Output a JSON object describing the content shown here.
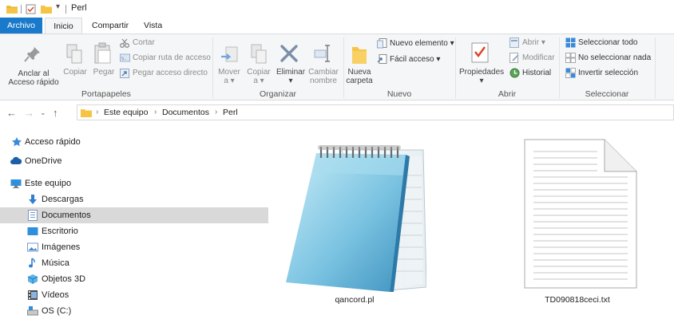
{
  "window": {
    "title": "Perl"
  },
  "tabs": [
    {
      "label": "Archivo"
    },
    {
      "label": "Inicio"
    },
    {
      "label": "Compartir"
    },
    {
      "label": "Vista"
    }
  ],
  "ribbon": {
    "portapapeles": {
      "label": "Portapapeles",
      "anclar_line1": "Anclar al",
      "anclar_line2": "Acceso rápido",
      "copiar": "Copiar",
      "pegar": "Pegar",
      "cortar": "Cortar",
      "copiar_ruta": "Copiar ruta de acceso",
      "pegar_acceso": "Pegar acceso directo"
    },
    "organizar": {
      "label": "Organizar",
      "mover_line1": "Mover",
      "mover_line2": "a",
      "copiar_line1": "Copiar",
      "copiar_line2": "a",
      "eliminar": "Eliminar",
      "cambiar_line1": "Cambiar",
      "cambiar_line2": "nombre"
    },
    "nuevo": {
      "label": "Nuevo",
      "carpeta_line1": "Nueva",
      "carpeta_line2": "carpeta",
      "nuevo_elemento": "Nuevo elemento",
      "facil_acceso": "Fácil acceso"
    },
    "abrir": {
      "label": "Abrir",
      "propiedades": "Propiedades",
      "abrir": "Abrir",
      "modificar": "Modificar",
      "historial": "Historial"
    },
    "seleccionar": {
      "label": "Seleccionar",
      "todo": "Seleccionar todo",
      "nada": "No seleccionar nada",
      "invertir": "Invertir selección"
    }
  },
  "address": {
    "crumbs": [
      "Este equipo",
      "Documentos",
      "Perl"
    ]
  },
  "nav": {
    "items": [
      {
        "label": "Acceso rápido",
        "icon": "star-icon"
      },
      {
        "label": "OneDrive",
        "icon": "cloud-icon"
      },
      {
        "label": "Este equipo",
        "icon": "computer-icon"
      },
      {
        "label": "Descargas",
        "icon": "download-icon"
      },
      {
        "label": "Documentos",
        "icon": "documents-icon",
        "selected": true
      },
      {
        "label": "Escritorio",
        "icon": "desktop-icon"
      },
      {
        "label": "Imágenes",
        "icon": "pictures-icon"
      },
      {
        "label": "Música",
        "icon": "music-icon"
      },
      {
        "label": "Objetos 3D",
        "icon": "cube-icon"
      },
      {
        "label": "Vídeos",
        "icon": "videos-icon"
      },
      {
        "label": "OS (C:)",
        "icon": "drive-icon"
      }
    ]
  },
  "files": [
    {
      "name": "qancord.pl",
      "icon": "notepad-icon"
    },
    {
      "name": "TD090818ceci.txt",
      "icon": "text-document-icon"
    }
  ],
  "colors": {
    "accent": "#1979ca",
    "ribbon_bg": "#f5f6f7",
    "selection": "#d9d9d9",
    "folder": "#f6c445"
  }
}
